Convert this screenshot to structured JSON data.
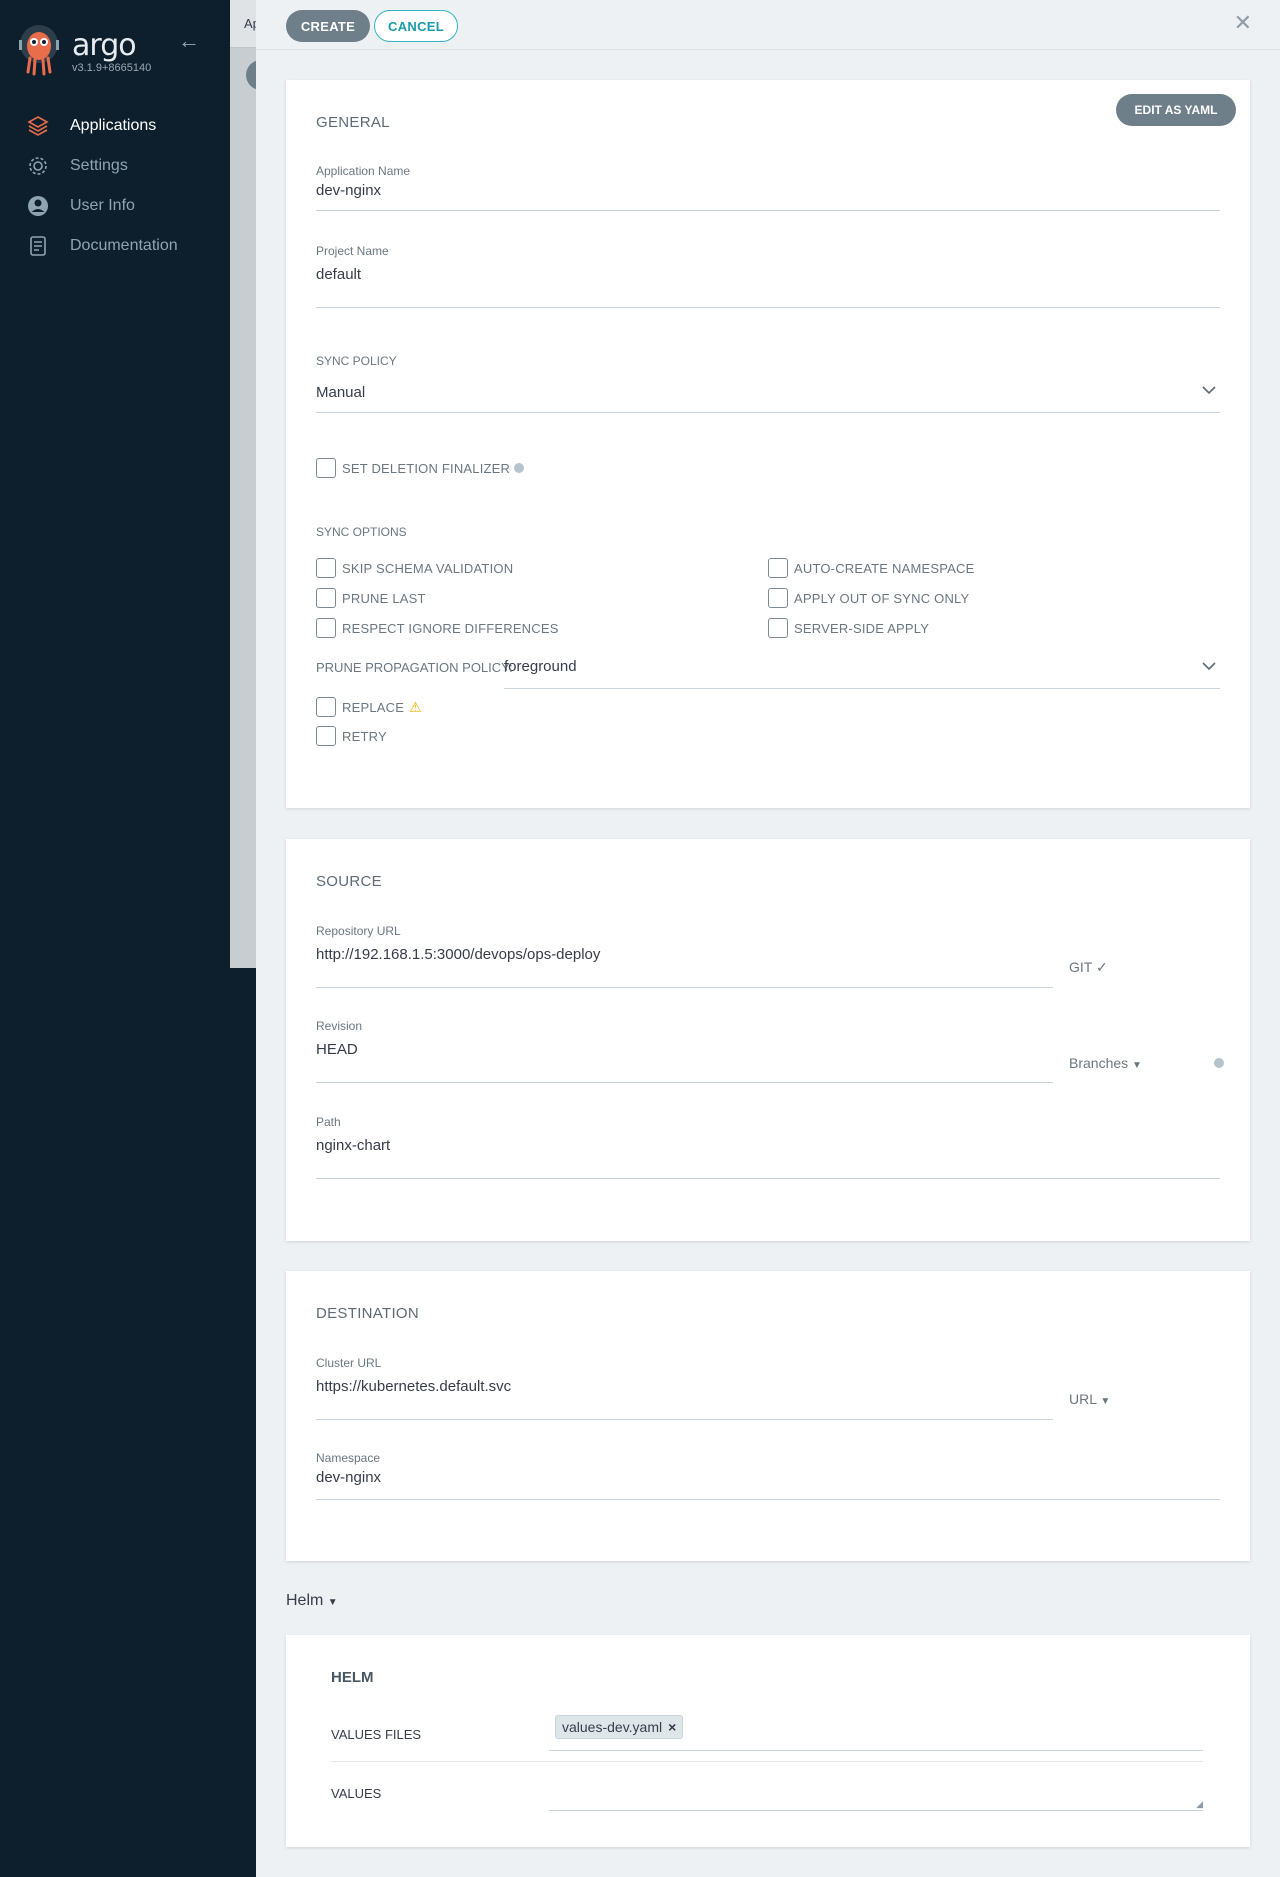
{
  "app": {
    "brand": "argo",
    "version": "v3.1.9+8665140",
    "back_label": "←"
  },
  "sidebar": {
    "items": [
      {
        "label": "Applications",
        "icon": "layers-icon",
        "active": true
      },
      {
        "label": "Settings",
        "icon": "gear-icon",
        "active": false
      },
      {
        "label": "User Info",
        "icon": "user-icon",
        "active": false
      },
      {
        "label": "Documentation",
        "icon": "book-icon",
        "active": false
      }
    ]
  },
  "background_page": {
    "tab_fragment": "Ap"
  },
  "toolbar": {
    "create_label": "CREATE",
    "cancel_label": "CANCEL",
    "close_glyph": "✕"
  },
  "general": {
    "title": "GENERAL",
    "edit_yaml_label": "EDIT AS YAML",
    "app_name_label": "Application Name",
    "app_name_value": "dev-nginx",
    "project_label": "Project Name",
    "project_value": "default",
    "sync_policy_label": "SYNC POLICY",
    "sync_policy_value": "Manual",
    "deletion_finalizer_label": "SET DELETION FINALIZER",
    "sync_options_label": "SYNC OPTIONS",
    "options_left": [
      "SKIP SCHEMA VALIDATION",
      "PRUNE LAST",
      "RESPECT IGNORE DIFFERENCES"
    ],
    "options_right": [
      "AUTO-CREATE NAMESPACE",
      "APPLY OUT OF SYNC ONLY",
      "SERVER-SIDE APPLY"
    ],
    "prune_policy_label": "PRUNE PROPAGATION POLICY:",
    "prune_policy_value": "foreground",
    "replace_label": "REPLACE",
    "retry_label": "RETRY"
  },
  "source": {
    "title": "SOURCE",
    "repo_label": "Repository URL",
    "repo_value": "http://192.168.1.5:3000/devops/ops-deploy",
    "repo_type": "GIT",
    "revision_label": "Revision",
    "revision_value": "HEAD",
    "revision_type": "Branches",
    "path_label": "Path",
    "path_value": "nginx-chart"
  },
  "destination": {
    "title": "DESTINATION",
    "cluster_label": "Cluster URL",
    "cluster_value": "https://kubernetes.default.svc",
    "cluster_type": "URL",
    "namespace_label": "Namespace",
    "namespace_value": "dev-nginx"
  },
  "helm": {
    "toggle_label": "Helm",
    "title": "HELM",
    "values_files_label": "VALUES FILES",
    "values_files": [
      "values-dev.yaml"
    ],
    "values_label": "VALUES"
  },
  "colors": {
    "sidebar_bg": "#0d1f2d",
    "accent": "#37b4c2",
    "button_grey": "#6f7f8a"
  }
}
